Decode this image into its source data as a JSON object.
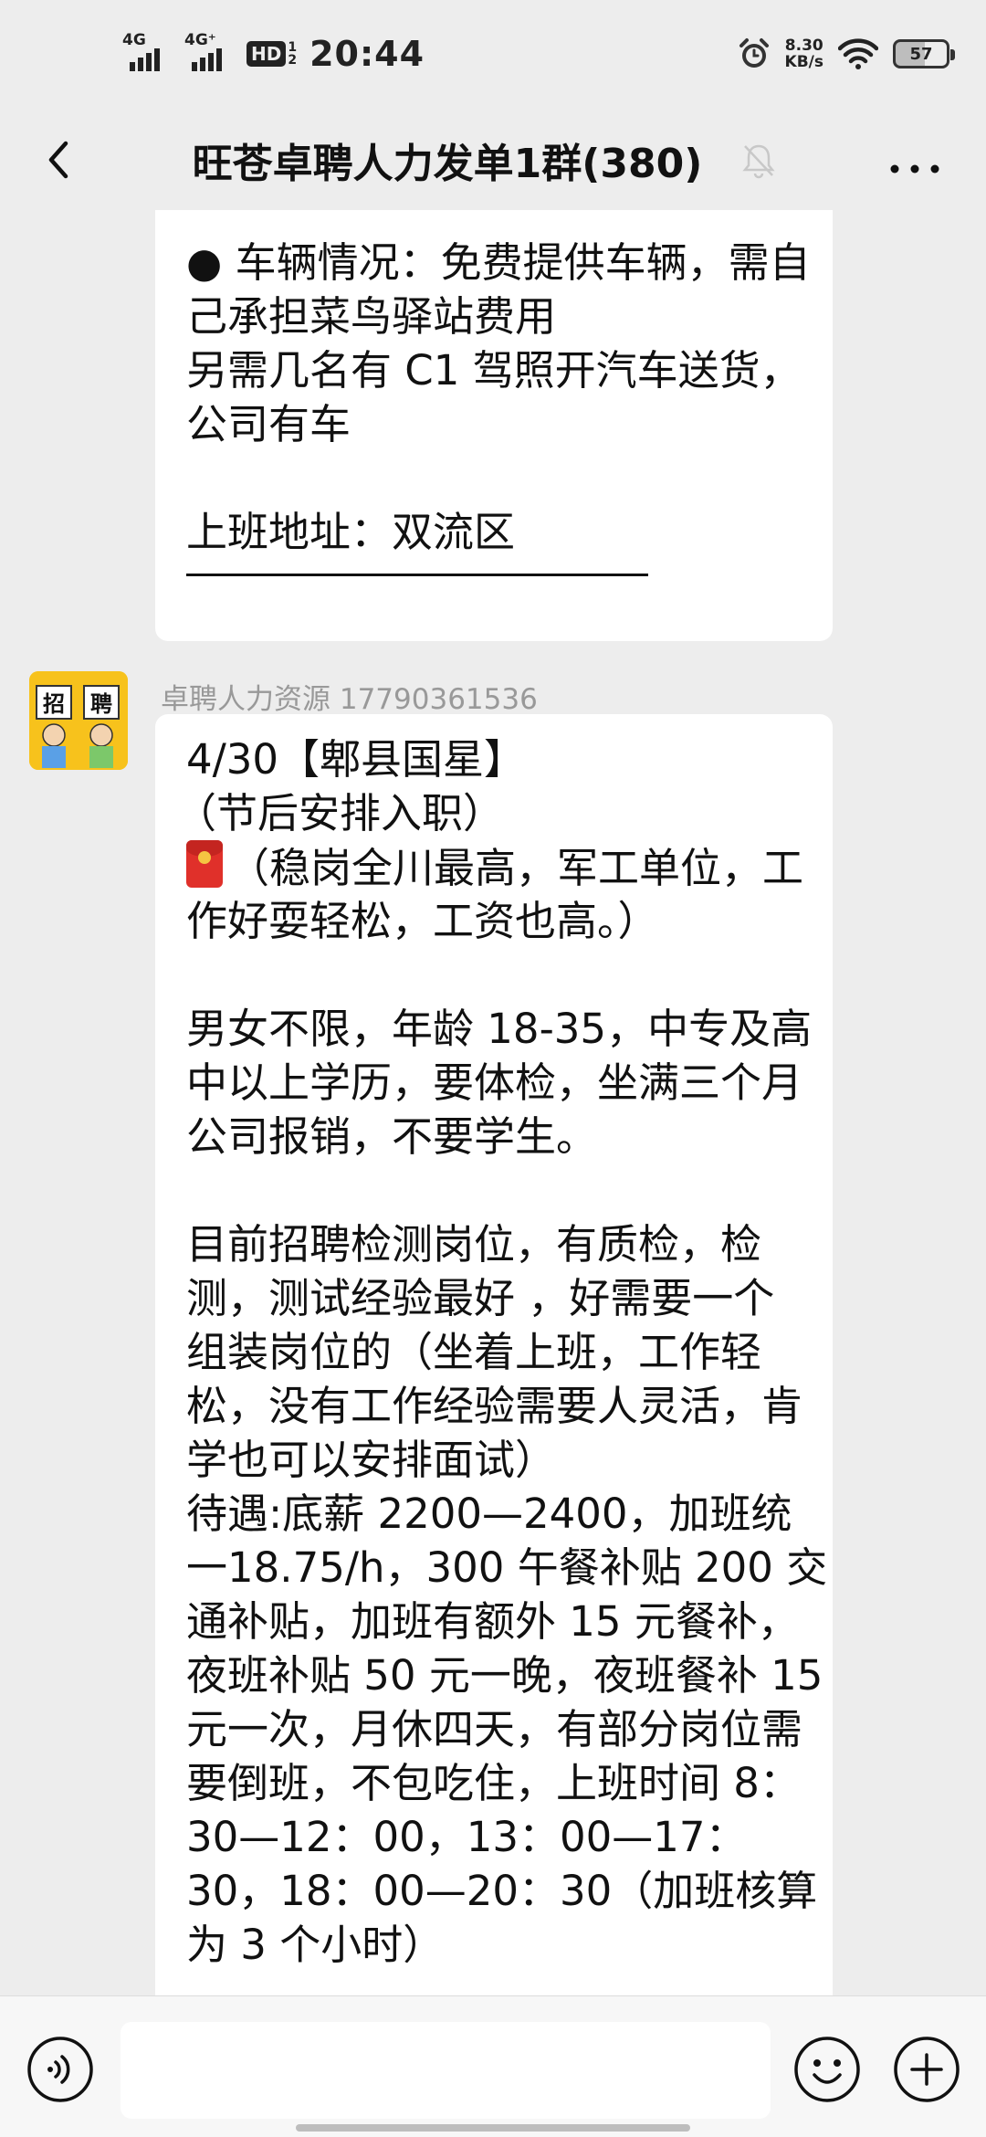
{
  "status_bar": {
    "signal1_label": "4G",
    "signal2_label": "4G⁺",
    "hd_label": "HD",
    "hd_sub_top": "1",
    "hd_sub_bottom": "2",
    "time": "20:44",
    "alarm_icon": "alarm-clock-icon",
    "net_speed_value": "8.30",
    "net_speed_unit": "KB/s",
    "wifi_icon": "wifi-icon",
    "battery_level": "57"
  },
  "header": {
    "title": "旺苍卓聘人力发单1群(380)",
    "back_icon": "chevron-left-icon",
    "mute_icon": "bell-muted-icon",
    "more_icon": "more-dots-icon"
  },
  "messages": [
    {
      "sender": "",
      "lines": [
        "● 车辆情况：免费提供车辆，需自",
        "己承担菜鸟驿站费用",
        "另需几名有 C1 驾照开汽车送货，",
        "公司有车",
        "",
        "上班地址：双流区"
      ]
    },
    {
      "sender": "卓聘人力资源 17790361536",
      "avatar_text_left": "招",
      "avatar_text_right": "聘",
      "lines": [
        "4/30【郫县国星】",
        "（节后安排入职）",
        "（稳岗全川最高，军工单位，工",
        "作好耍轻松，工资也高。）",
        "",
        "男女不限，年龄 18-35，中专及高",
        "中以上学历，要体检，坐满三个月",
        "公司报销，不要学生。",
        "",
        "目前招聘检测岗位，有质检，检",
        "测，测试经验最好 ，好需要一个",
        "组装岗位的（坐着上班，工作轻",
        "松，没有工作经验需要人灵活，肯",
        "学也可以安排面试）",
        "待遇:底薪 2200—2400，加班统",
        "一18.75/h，300 午餐补贴 200 交",
        "通补贴，加班有额外 15 元餐补，",
        "夜班补贴 50 元一晚，夜班餐补 15",
        "元一次，月休四天，有部分岗位需",
        "要倒班，不包吃住，上班时间 8：",
        "30—12：00，13：00—17：",
        "30，18：00—20：30（加班核算",
        "为 3 个小时）"
      ]
    }
  ],
  "input_bar": {
    "voice_icon": "voice-icon",
    "input_value": "",
    "emoji_icon": "emoji-icon",
    "plus_icon": "plus-icon"
  }
}
